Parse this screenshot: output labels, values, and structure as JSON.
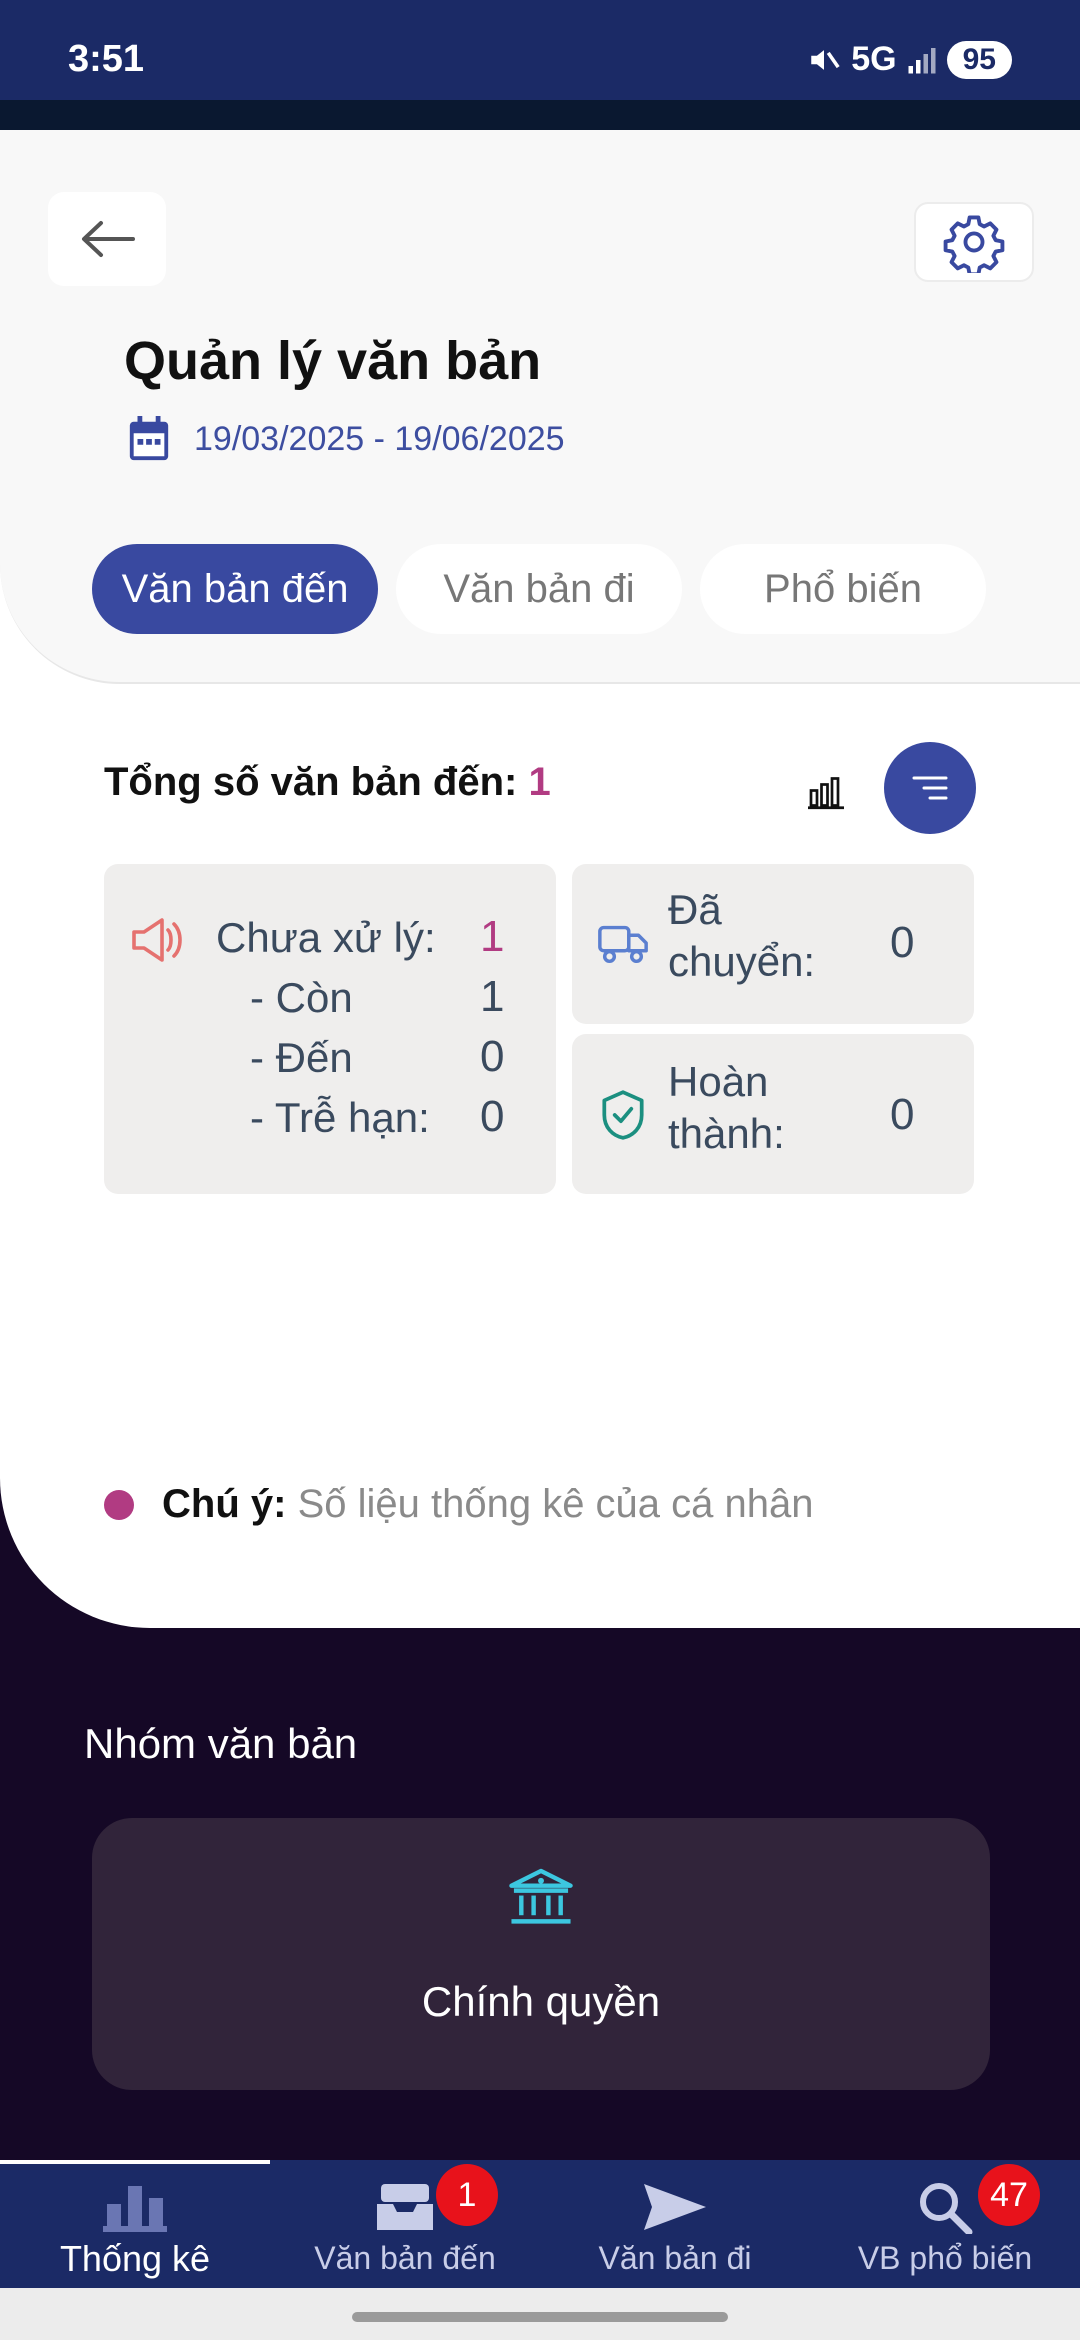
{
  "status_bar": {
    "time": "3:51",
    "network": "5G",
    "battery": "95"
  },
  "header": {
    "title": "Quản lý văn bản",
    "date_range": "19/03/2025 - 19/06/2025"
  },
  "tabs": [
    {
      "label": "Văn bản đến",
      "active": true
    },
    {
      "label": "Văn bản đi",
      "active": false
    },
    {
      "label": "Phổ biến",
      "active": false
    }
  ],
  "summary": {
    "label": "Tổng số văn bản đến:",
    "count": "1"
  },
  "stats": {
    "pending": {
      "label": "Chưa xử lý:",
      "value": "1",
      "rows": [
        {
          "label": "- Còn",
          "value": "1"
        },
        {
          "label": "- Đến",
          "value": "0"
        },
        {
          "label": "- Trễ hạn:",
          "value": "0"
        }
      ]
    },
    "transferred": {
      "label_line1": "Đã",
      "label_line2": "chuyển:",
      "value": "0"
    },
    "completed": {
      "label_line1": "Hoàn",
      "label_line2": "thành:",
      "value": "0"
    }
  },
  "note": {
    "bold": "Chú ý:",
    "text": "Số liệu thống kê của cá nhân"
  },
  "group": {
    "title": "Nhóm văn bản",
    "card_label": "Chính quyền"
  },
  "bottom_nav": [
    {
      "label": "Thống kê",
      "icon": "bar-chart-icon",
      "active": true,
      "badge": ""
    },
    {
      "label": "Văn bản đến",
      "icon": "inbox-icon",
      "active": false,
      "badge": "1"
    },
    {
      "label": "Văn bản đi",
      "icon": "send-icon",
      "active": false,
      "badge": ""
    },
    {
      "label": "VB phổ biến",
      "icon": "search-icon",
      "active": false,
      "badge": "47"
    }
  ],
  "colors": {
    "primary": "#3949a0",
    "accent": "#b13b82",
    "nav_bg": "#1b2a66",
    "badge": "#e8121b"
  }
}
